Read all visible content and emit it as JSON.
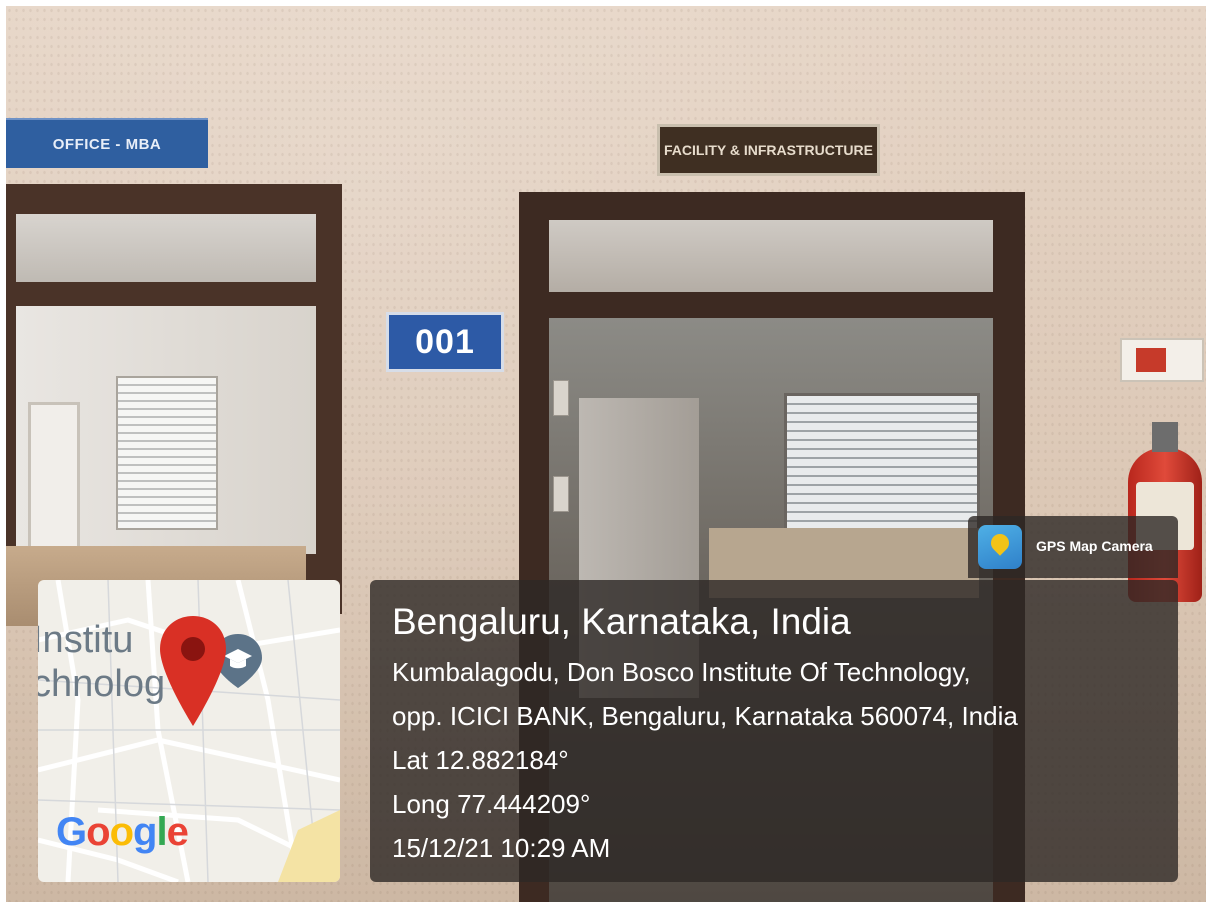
{
  "scene": {
    "sign_office": "OFFICE - MBA",
    "sign_facility": "FACILITY & INFRASTRUCTURE",
    "sign_room": "001"
  },
  "gps_overlay": {
    "app_name": "GPS Map Camera",
    "location_title": "Bengaluru, Karnataka, India",
    "address_line1": "Kumbalagodu, Don Bosco Institute Of Technology,",
    "address_line2": "opp. ICICI BANK, Bengaluru, Karnataka 560074, India",
    "latitude": "Lat 12.882184°",
    "longitude": "Long 77.444209°",
    "timestamp": "15/12/21 10:29 AM",
    "map": {
      "place_label_line1": "Institu",
      "place_label_line2": "chnolog",
      "logo_text": "Google",
      "marker_color": "#d93025"
    }
  }
}
